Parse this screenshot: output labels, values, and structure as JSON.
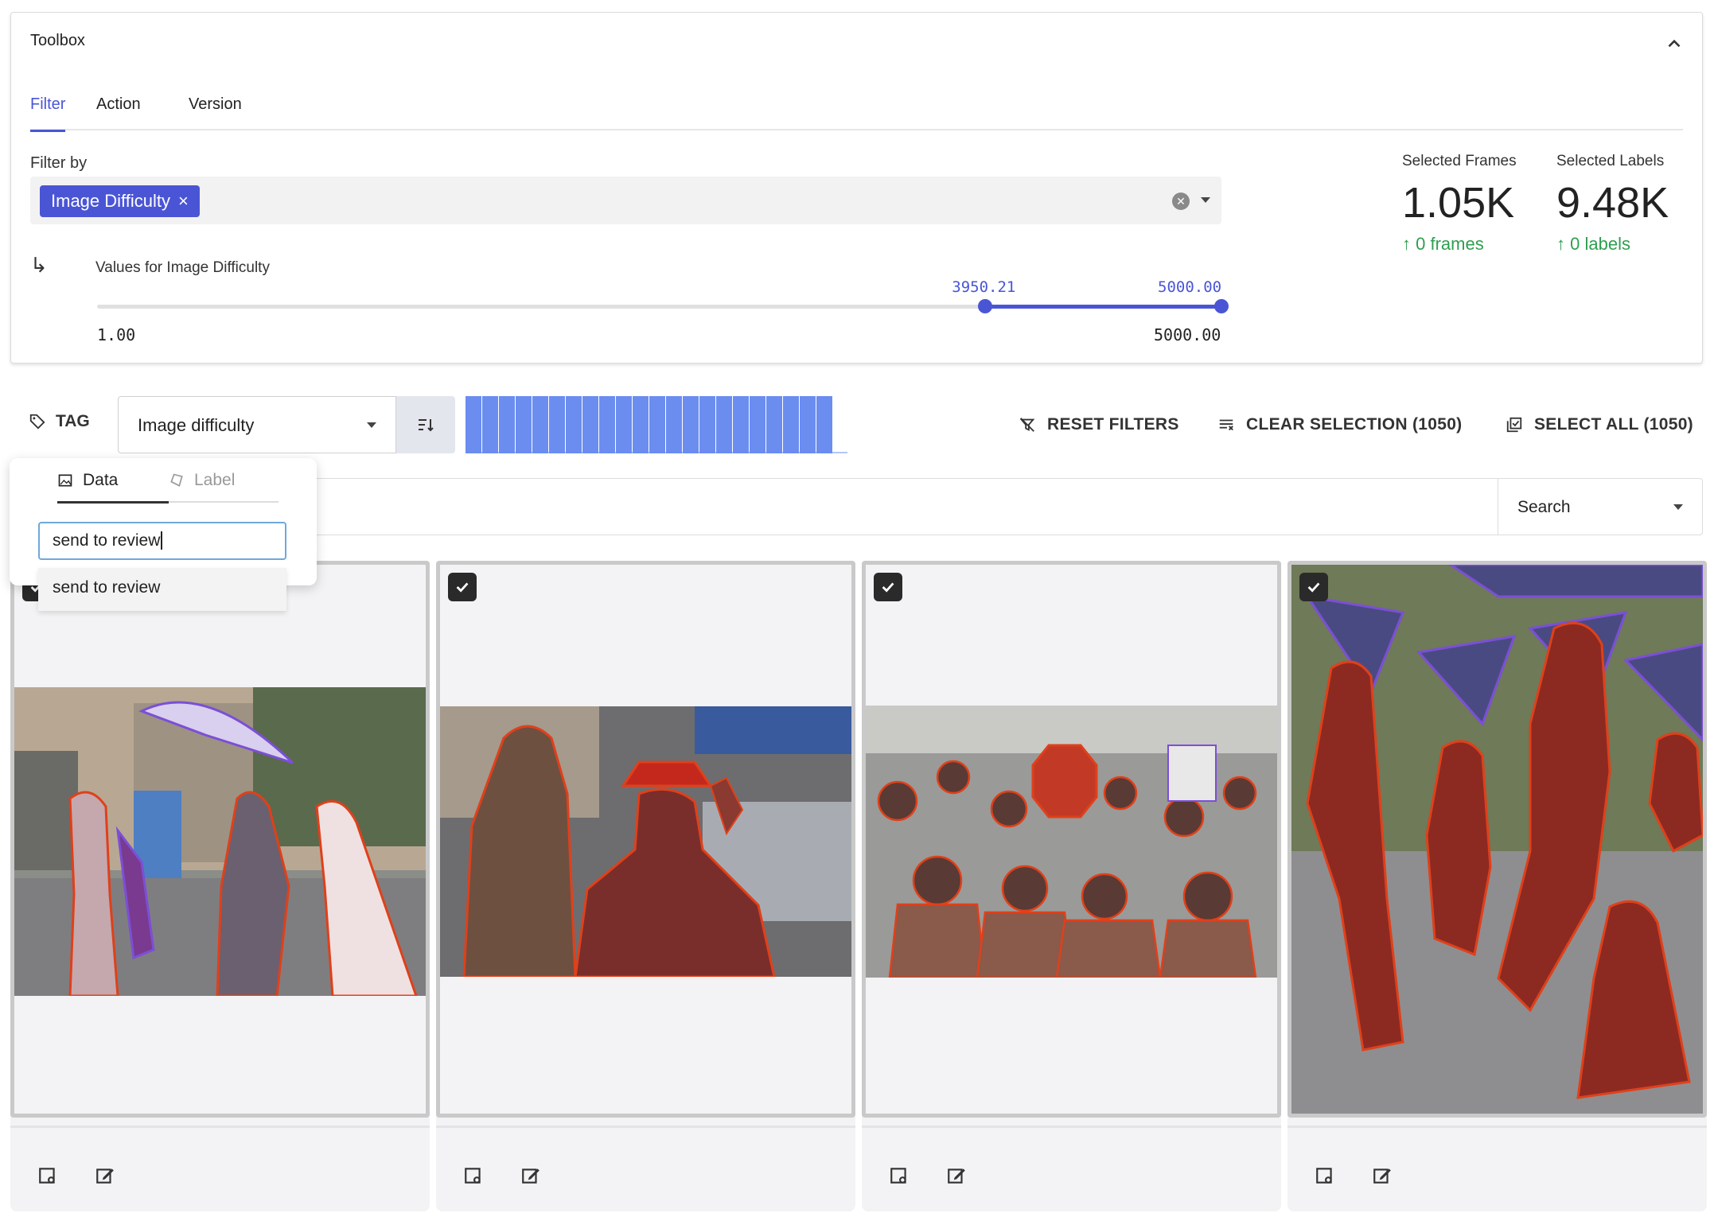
{
  "toolbox": {
    "title": "Toolbox",
    "tabs": [
      "Filter",
      "Action",
      "Version"
    ],
    "active_tab": "Filter",
    "filter_by_label": "Filter by",
    "chip_label": "Image Difficulty",
    "values_label": "Values for Image Difficulty",
    "slider": {
      "min": "1.00",
      "max": "5000.00",
      "low": "3950.21",
      "high": "5000.00",
      "low_fraction": 0.79,
      "high_fraction": 1.0
    },
    "stats": [
      {
        "label": "Selected Frames",
        "value": "1.05K",
        "delta": "0 frames"
      },
      {
        "label": "Selected Labels",
        "value": "9.48K",
        "delta": "0 labels"
      }
    ]
  },
  "toolbar": {
    "tag_label": "TAG",
    "sort_label": "Image difficulty",
    "reset_label": "RESET FILTERS",
    "clear_label": "CLEAR SELECTION (1050)",
    "select_all_label": "SELECT ALL (1050)"
  },
  "search": {
    "type_label": "Search"
  },
  "popover": {
    "tabs": [
      "Data",
      "Label"
    ],
    "active_tab": "Data",
    "input_value": "send to review",
    "suggestion": "send to review"
  },
  "cards": [
    {
      "selected": true,
      "scene": "wedding street with parasol"
    },
    {
      "selected": true,
      "scene": "men in hats on street"
    },
    {
      "selected": true,
      "scene": "protest crowd with stop sign"
    },
    {
      "selected": true,
      "scene": "folk dancers with umbrellas"
    }
  ],
  "colors": {
    "accent": "#4a55d6",
    "positive": "#2e9e4f",
    "histogram": "#6b8df0",
    "annotation_outline": "#e0401a",
    "annotation_purple": "#7b4fd6"
  }
}
